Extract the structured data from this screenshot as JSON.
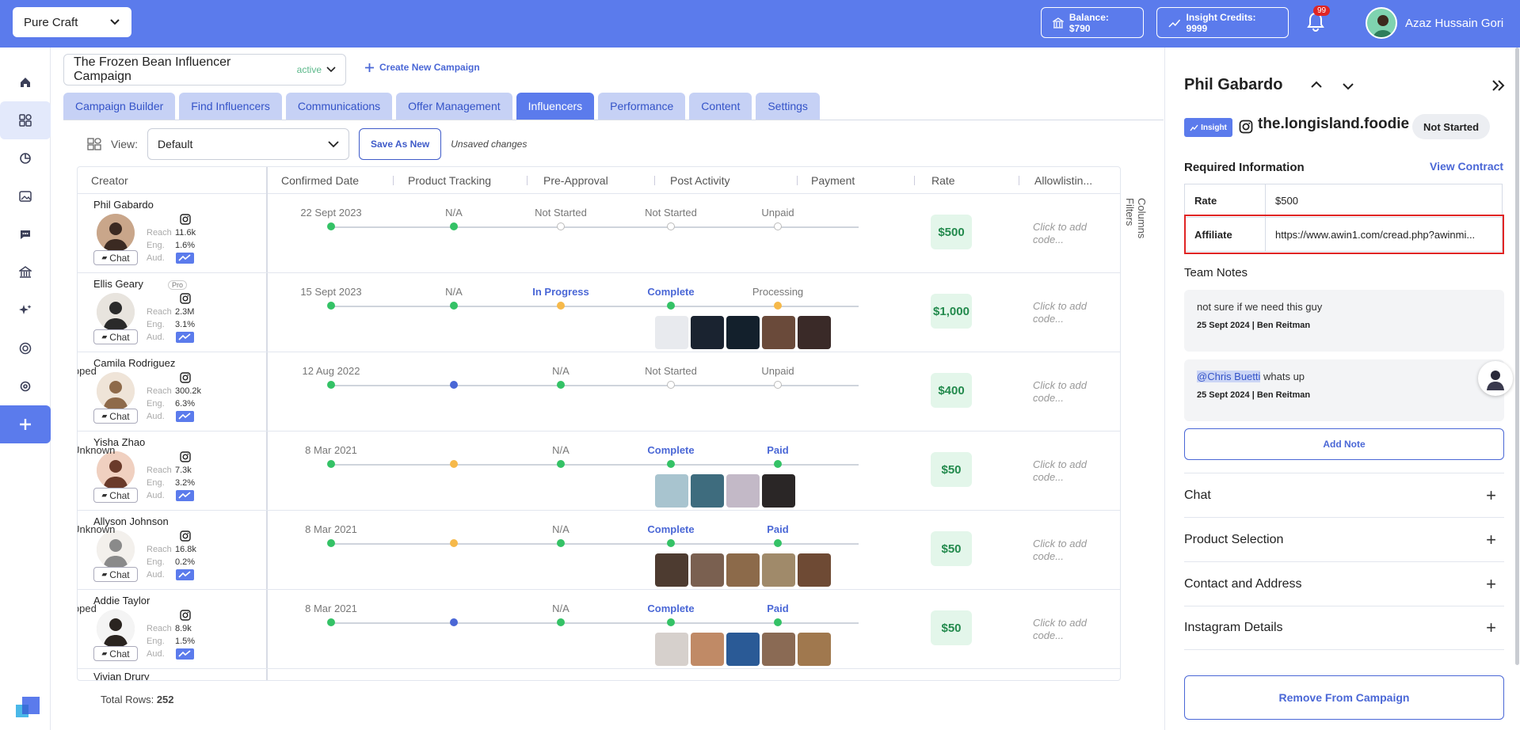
{
  "topbar": {
    "brand": "Pure Craft",
    "balance": "Balance: $790",
    "credits": "Insight Credits: 9999",
    "notifications": "99",
    "user_name": "Azaz Hussain Gori"
  },
  "campaign": {
    "title": "The Frozen Bean Influencer Campaign",
    "status": "active",
    "create_new": "Create New Campaign"
  },
  "tabs": [
    "Campaign Builder",
    "Find Influencers",
    "Communications",
    "Offer Management",
    "Influencers",
    "Performance",
    "Content",
    "Settings"
  ],
  "active_tab": "Influencers",
  "view": {
    "label": "View:",
    "value": "Default",
    "save_as": "Save As New",
    "unsaved": "Unsaved changes"
  },
  "columns": [
    "Creator",
    "Confirmed Date",
    "Product Tracking",
    "Pre-Approval",
    "Post Activity",
    "Payment",
    "Rate",
    "Allowlistin..."
  ],
  "side_tools": {
    "columns": "Columns",
    "filters": "Filters"
  },
  "stat_labels": {
    "reach": "Reach",
    "eng": "Eng.",
    "aud": "Aud.",
    "chat": "Chat",
    "pro": "Pro",
    "allow": "Click to add code..."
  },
  "rows": [
    {
      "name": "Phil Gabardo",
      "reach": "11.6k",
      "eng": "1.6%",
      "date": "22 Sept 2023",
      "tracking": "N/A",
      "preapproval": "Not Started",
      "post": "Not Started",
      "payment": "Unpaid",
      "rate": "$500",
      "dots": [
        "green",
        "green",
        "empty",
        "empty",
        "empty"
      ],
      "styles": [
        "",
        "",
        "",
        "",
        ""
      ],
      "thumbs": []
    },
    {
      "name": "Ellis Geary",
      "pro": true,
      "reach": "2.3M",
      "eng": "3.1%",
      "date": "15 Sept 2023",
      "tracking": "N/A",
      "preapproval": "In Progress",
      "post": "Complete",
      "payment": "Processing",
      "rate": "$1,000",
      "dots": [
        "green",
        "green",
        "orange",
        "green",
        "orange"
      ],
      "styles": [
        "",
        "",
        "blue",
        "blue",
        ""
      ],
      "thumbs": [
        "#e8eaee",
        "#1a2330",
        "#13202c",
        "#6a4a3a",
        "#3a2a28"
      ]
    },
    {
      "name": "Camila Rodriguez",
      "reach": "300.2k",
      "eng": "6.3%",
      "date": "12 Aug 2022",
      "tracking": "Shipped",
      "preapproval": "N/A",
      "post": "Not Started",
      "payment": "Unpaid",
      "rate": "$400",
      "dots": [
        "green",
        "blue",
        "green",
        "empty",
        "empty"
      ],
      "styles": [
        "",
        "dark",
        "",
        "",
        ""
      ],
      "thumbs": []
    },
    {
      "name": "Yisha Zhao",
      "reach": "7.3k",
      "eng": "3.2%",
      "date": "8 Mar 2021",
      "tracking": "Status Unknown",
      "preapproval": "N/A",
      "post": "Complete",
      "payment": "Paid",
      "rate": "$50",
      "dots": [
        "green",
        "orange",
        "green",
        "green",
        "green"
      ],
      "styles": [
        "",
        "dark",
        "",
        "blue",
        "blue"
      ],
      "thumbs": [
        "#a8c4cf",
        "#3e6c7e",
        "#c3b9c7",
        "#2a2626"
      ]
    },
    {
      "name": "Allyson Johnson",
      "reach": "16.8k",
      "eng": "0.2%",
      "date": "8 Mar 2021",
      "tracking": "Status Unknown",
      "preapproval": "N/A",
      "post": "Complete",
      "payment": "Paid",
      "rate": "$50",
      "dots": [
        "green",
        "orange",
        "green",
        "green",
        "green"
      ],
      "styles": [
        "",
        "dark",
        "",
        "blue",
        "blue"
      ],
      "thumbs": [
        "#4d3b30",
        "#7a6050",
        "#8c6a4a",
        "#a08a6a",
        "#6e4a34"
      ]
    },
    {
      "name": "Addie Taylor",
      "reach": "8.9k",
      "eng": "1.5%",
      "date": "8 Mar 2021",
      "tracking": "Shipped",
      "preapproval": "N/A",
      "post": "Complete",
      "payment": "Paid",
      "rate": "$50",
      "dots": [
        "green",
        "blue",
        "green",
        "green",
        "green"
      ],
      "styles": [
        "",
        "dark",
        "",
        "blue",
        "blue"
      ],
      "thumbs": [
        "#d6d0cc",
        "#c08a66",
        "#2a5a96",
        "#8a6a54",
        "#a0784e"
      ]
    }
  ],
  "next_row_name": "Vivian Drury",
  "total_rows": {
    "label": "Total Rows:",
    "value": "252"
  },
  "panel": {
    "name": "Phil Gabardo",
    "insight": "Insight",
    "handle": "the.longisland.foodie",
    "status": "Not Started",
    "required": "Required Information",
    "view_contract": "View Contract",
    "rate_label": "Rate",
    "rate_value": "$500",
    "affiliate_label": "Affiliate",
    "affiliate_value": "https://www.awin1.com/cread.php?awinmi...",
    "team_notes": "Team Notes",
    "note1": "not sure if we need this guy",
    "note1_meta": "25 Sept 2024 | Ben Reitman",
    "note2_mention": "@Chris Buetti",
    "note2_text": " whats up",
    "note2_meta": "25 Sept 2024 | Ben Reitman",
    "add_note": "Add Note",
    "sections": [
      "Chat",
      "Product Selection",
      "Contact and Address",
      "Instagram Details"
    ],
    "remove": "Remove From Campaign"
  }
}
